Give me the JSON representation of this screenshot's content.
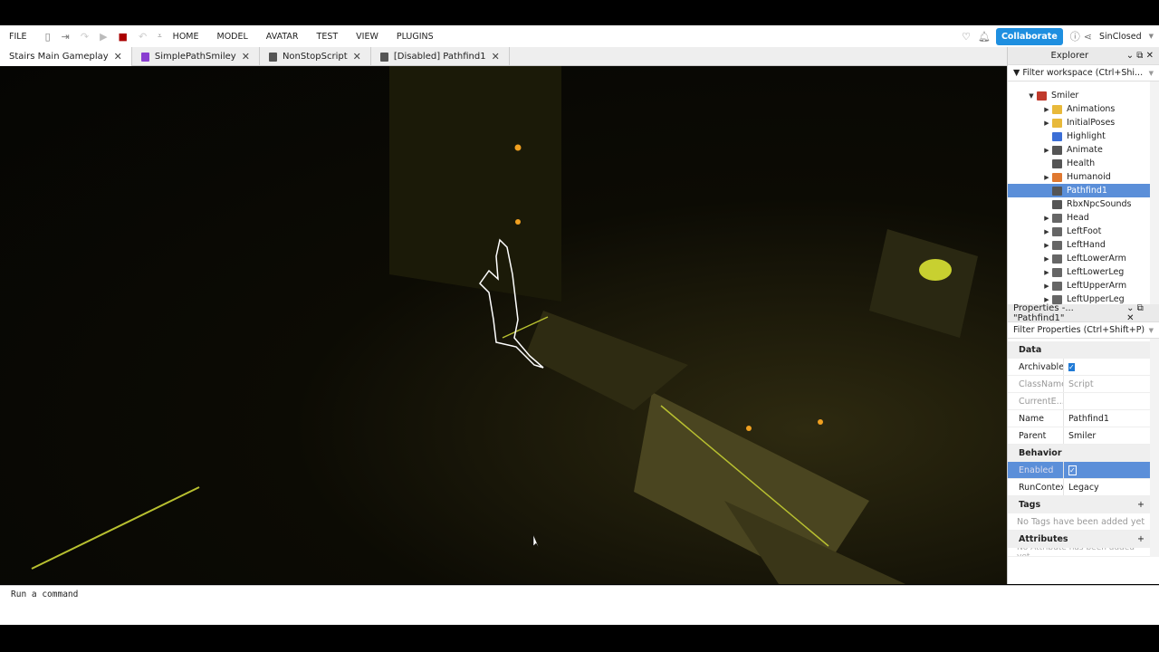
{
  "menu": {
    "file": "FILE",
    "items": [
      "HOME",
      "MODEL",
      "AVATAR",
      "TEST",
      "VIEW",
      "PLUGINS"
    ],
    "collaborate": "Collaborate",
    "user": "SinClosed"
  },
  "tabs": [
    {
      "label": "Stairs Main Gameplay",
      "icon": "none"
    },
    {
      "label": "SimplePathSmiley",
      "icon": "module-script-icon"
    },
    {
      "label": "NonStopScript",
      "icon": "script-icon"
    },
    {
      "label": "[Disabled] Pathfind1",
      "icon": "script-icon"
    }
  ],
  "explorer": {
    "title": "Explorer",
    "filter": "Filter workspace (Ctrl+Shi...",
    "items": [
      {
        "label": "Smiler",
        "level": 0,
        "expanded": true,
        "color": "#c0392b"
      },
      {
        "label": "Animations",
        "level": 1,
        "arrow": true,
        "color": "#e8b93a"
      },
      {
        "label": "InitialPoses",
        "level": 1,
        "arrow": true,
        "color": "#e8b93a"
      },
      {
        "label": "Highlight",
        "level": 1,
        "arrow": false,
        "color": "#3b6ed6"
      },
      {
        "label": "Animate",
        "level": 1,
        "arrow": true,
        "color": "#555"
      },
      {
        "label": "Health",
        "level": 1,
        "arrow": false,
        "color": "#555"
      },
      {
        "label": "Humanoid",
        "level": 1,
        "arrow": true,
        "color": "#e0782f"
      },
      {
        "label": "Pathfind1",
        "level": 1,
        "arrow": false,
        "color": "#555",
        "selected": true
      },
      {
        "label": "RbxNpcSounds",
        "level": 1,
        "arrow": false,
        "color": "#555"
      },
      {
        "label": "Head",
        "level": 1,
        "arrow": true,
        "color": "#666"
      },
      {
        "label": "LeftFoot",
        "level": 1,
        "arrow": true,
        "color": "#666"
      },
      {
        "label": "LeftHand",
        "level": 1,
        "arrow": true,
        "color": "#666"
      },
      {
        "label": "LeftLowerArm",
        "level": 1,
        "arrow": true,
        "color": "#666"
      },
      {
        "label": "LeftLowerLeg",
        "level": 1,
        "arrow": true,
        "color": "#666"
      },
      {
        "label": "LeftUpperArm",
        "level": 1,
        "arrow": true,
        "color": "#666"
      },
      {
        "label": "LeftUpperLeg",
        "level": 1,
        "arrow": true,
        "color": "#666"
      }
    ]
  },
  "properties": {
    "title": "Properties -... \"Pathfind1\"",
    "filter": "Filter Properties (Ctrl+Shift+P)",
    "data_label": "Data",
    "archivable": "Archivable",
    "classname": "ClassName",
    "classname_value": "Script",
    "current": "CurrentE...",
    "name": "Name",
    "name_value": "Pathfind1",
    "parent": "Parent",
    "parent_value": "Smiler",
    "behavior_label": "Behavior",
    "enabled": "Enabled",
    "runcontext": "RunContext",
    "runcontext_value": "Legacy",
    "tags_label": "Tags",
    "tags_empty": "No Tags have been added yet",
    "attributes_label": "Attributes",
    "attributes_empty": "No Attribute has been added yet"
  },
  "command": {
    "placeholder": "Run a command"
  }
}
